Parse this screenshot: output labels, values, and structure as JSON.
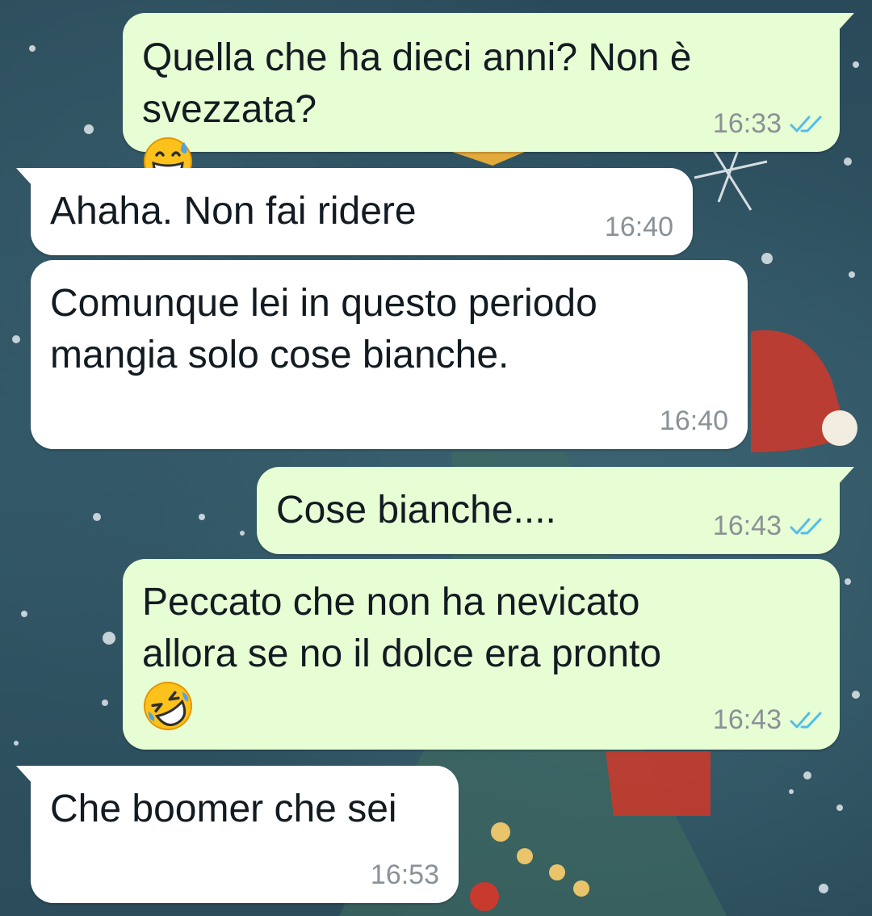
{
  "messages": [
    {
      "text": "Quella che ha dieci anni? Non è\nsvezzata?",
      "emoji": "grinning-face-with-sweat-icon",
      "time": "16:33",
      "direction": "outgoing",
      "status": "read"
    },
    {
      "text": "Ahaha. Non fai ridere",
      "time": "16:40",
      "direction": "incoming"
    },
    {
      "text": "Comunque lei in questo periodo\nmangia solo cose bianche.",
      "time": "16:40",
      "direction": "incoming"
    },
    {
      "text": "Cose bianche....",
      "time": "16:43",
      "direction": "outgoing",
      "status": "read"
    },
    {
      "text": "Peccato che non ha nevicato\nallora se no il dolce era pronto",
      "emoji": "rolling-on-the-floor-laughing-icon",
      "time": "16:43",
      "direction": "outgoing",
      "status": "read"
    },
    {
      "text": "Che boomer che sei",
      "time": "16:53",
      "direction": "incoming"
    }
  ],
  "colors": {
    "outgoing_bubble": "#e7fdd3",
    "incoming_bubble": "#ffffff",
    "read_ticks": "#53bdeb",
    "timestamp": "#8a9197",
    "wallpaper": "#2d4f5e"
  }
}
